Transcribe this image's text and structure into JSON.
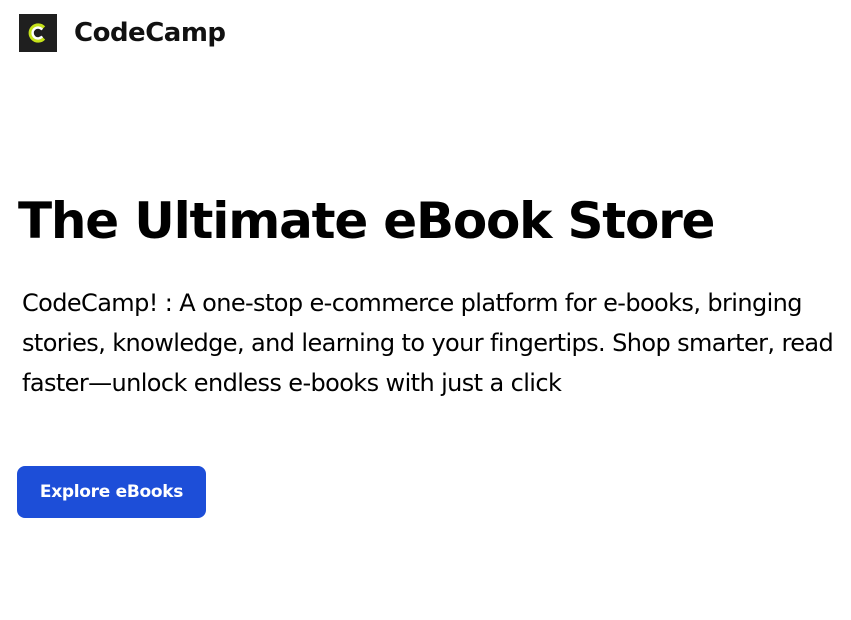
{
  "header": {
    "logo_icon": "codecamp-logo-icon",
    "brand_name": "CodeCamp"
  },
  "hero": {
    "title": "The Ultimate eBook Store",
    "description": "CodeCamp! : A one-stop e-commerce platform for e-books, bringing stories, knowledge, and learning to your fingertips. Shop smarter, read faster—unlock endless e-books with just a click",
    "cta_label": "Explore eBooks"
  },
  "colors": {
    "background": "#ffffff",
    "logo_bg": "#1f1f1f",
    "logo_accent": "#c6e21a",
    "cta_bg": "#1d4ed8",
    "cta_text": "#ffffff"
  }
}
